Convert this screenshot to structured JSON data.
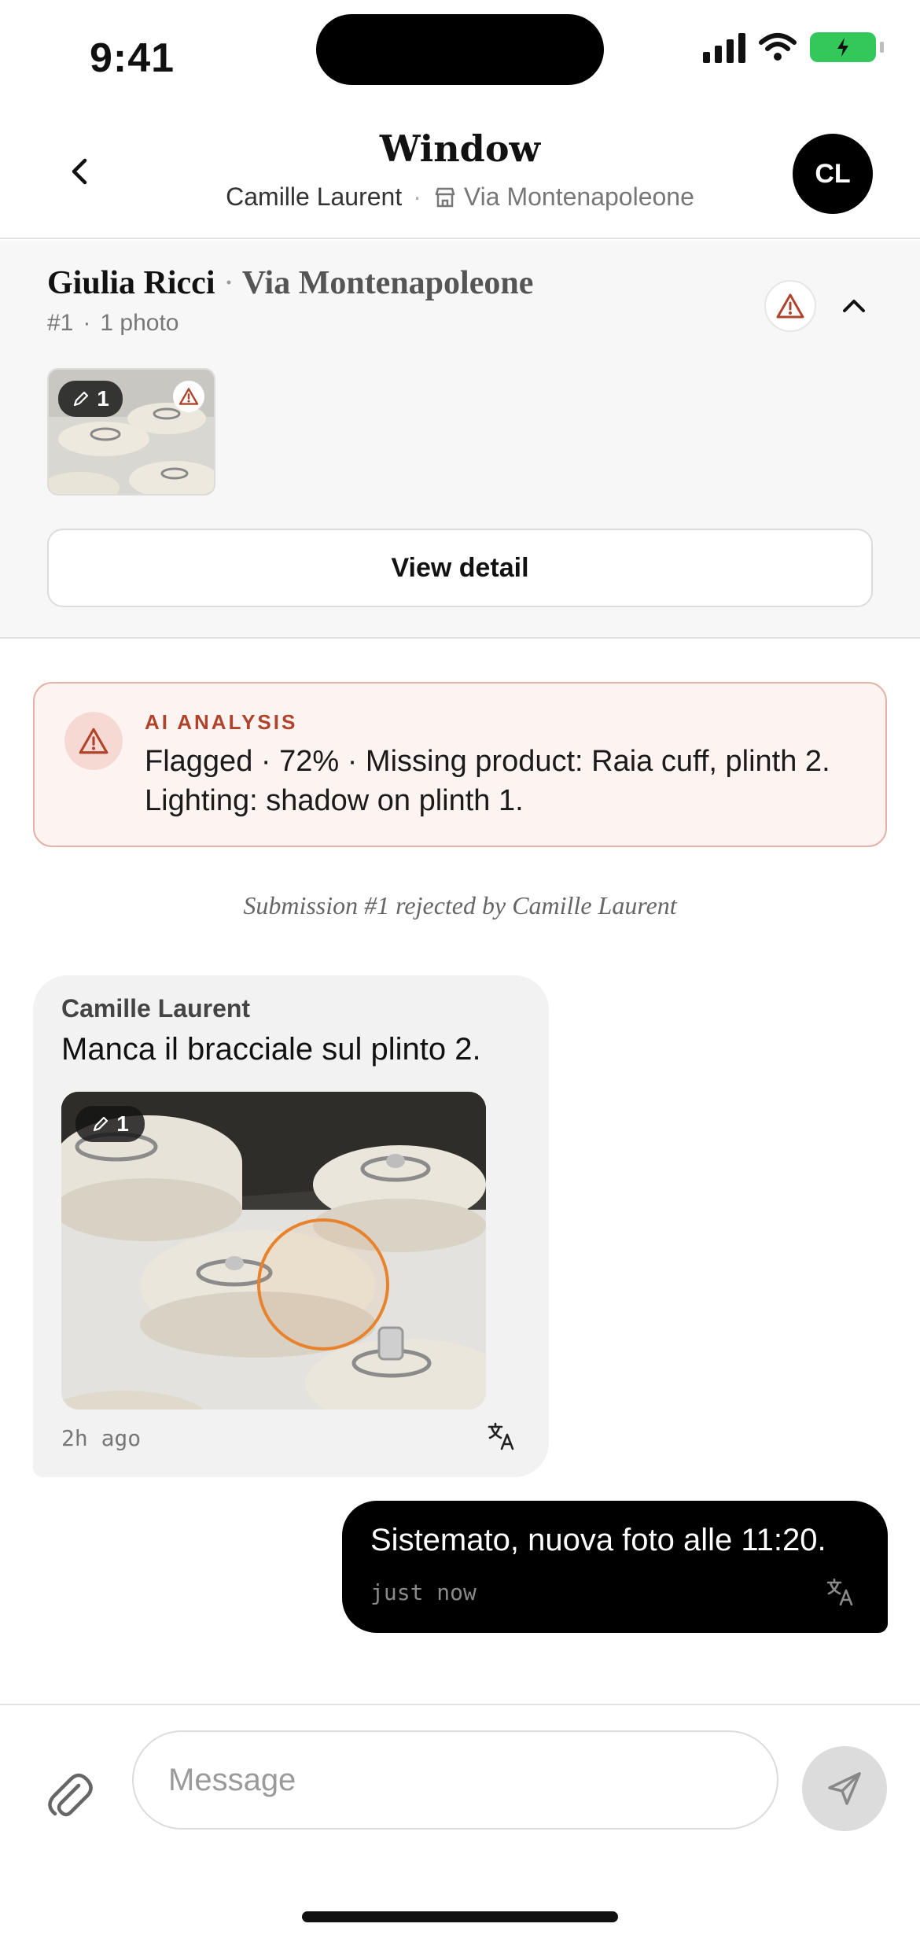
{
  "status_bar": {
    "time": "9:41"
  },
  "header": {
    "title": "Window",
    "user": "Camille Laurent",
    "separator": "·",
    "location": "Via Montenapoleone",
    "avatar_initials": "CL"
  },
  "submission": {
    "name": "Giulia Ricci",
    "separator": "·",
    "place": "Via Montenapoleone",
    "number": "#1",
    "meta_separator": "·",
    "photo_count": "1 photo",
    "annotation_count": "1",
    "view_button": "View detail"
  },
  "ai_analysis": {
    "label": "AI ANALYSIS",
    "text": "Flagged · 72% · Missing product: Raia cuff, plinth 2. Lighting: shadow on plinth 1."
  },
  "system_note": "Submission #1 rejected by Camille Laurent",
  "messages": [
    {
      "direction": "incoming",
      "sender": "Camille Laurent",
      "text": "Manca il bracciale sul plinto 2.",
      "annotation_count": "1",
      "time": "2h ago",
      "icon": "translate-icon"
    },
    {
      "direction": "outgoing",
      "text": "Sistemato, nuova foto alle 11:20.",
      "time": "just now",
      "icon": "translate-icon"
    }
  ],
  "composer": {
    "placeholder": "Message"
  },
  "colors": {
    "alert": "#b0432b",
    "alert_bg": "#fdf3f1",
    "battery": "#34c759",
    "annotation_ring": "#e8822c"
  }
}
